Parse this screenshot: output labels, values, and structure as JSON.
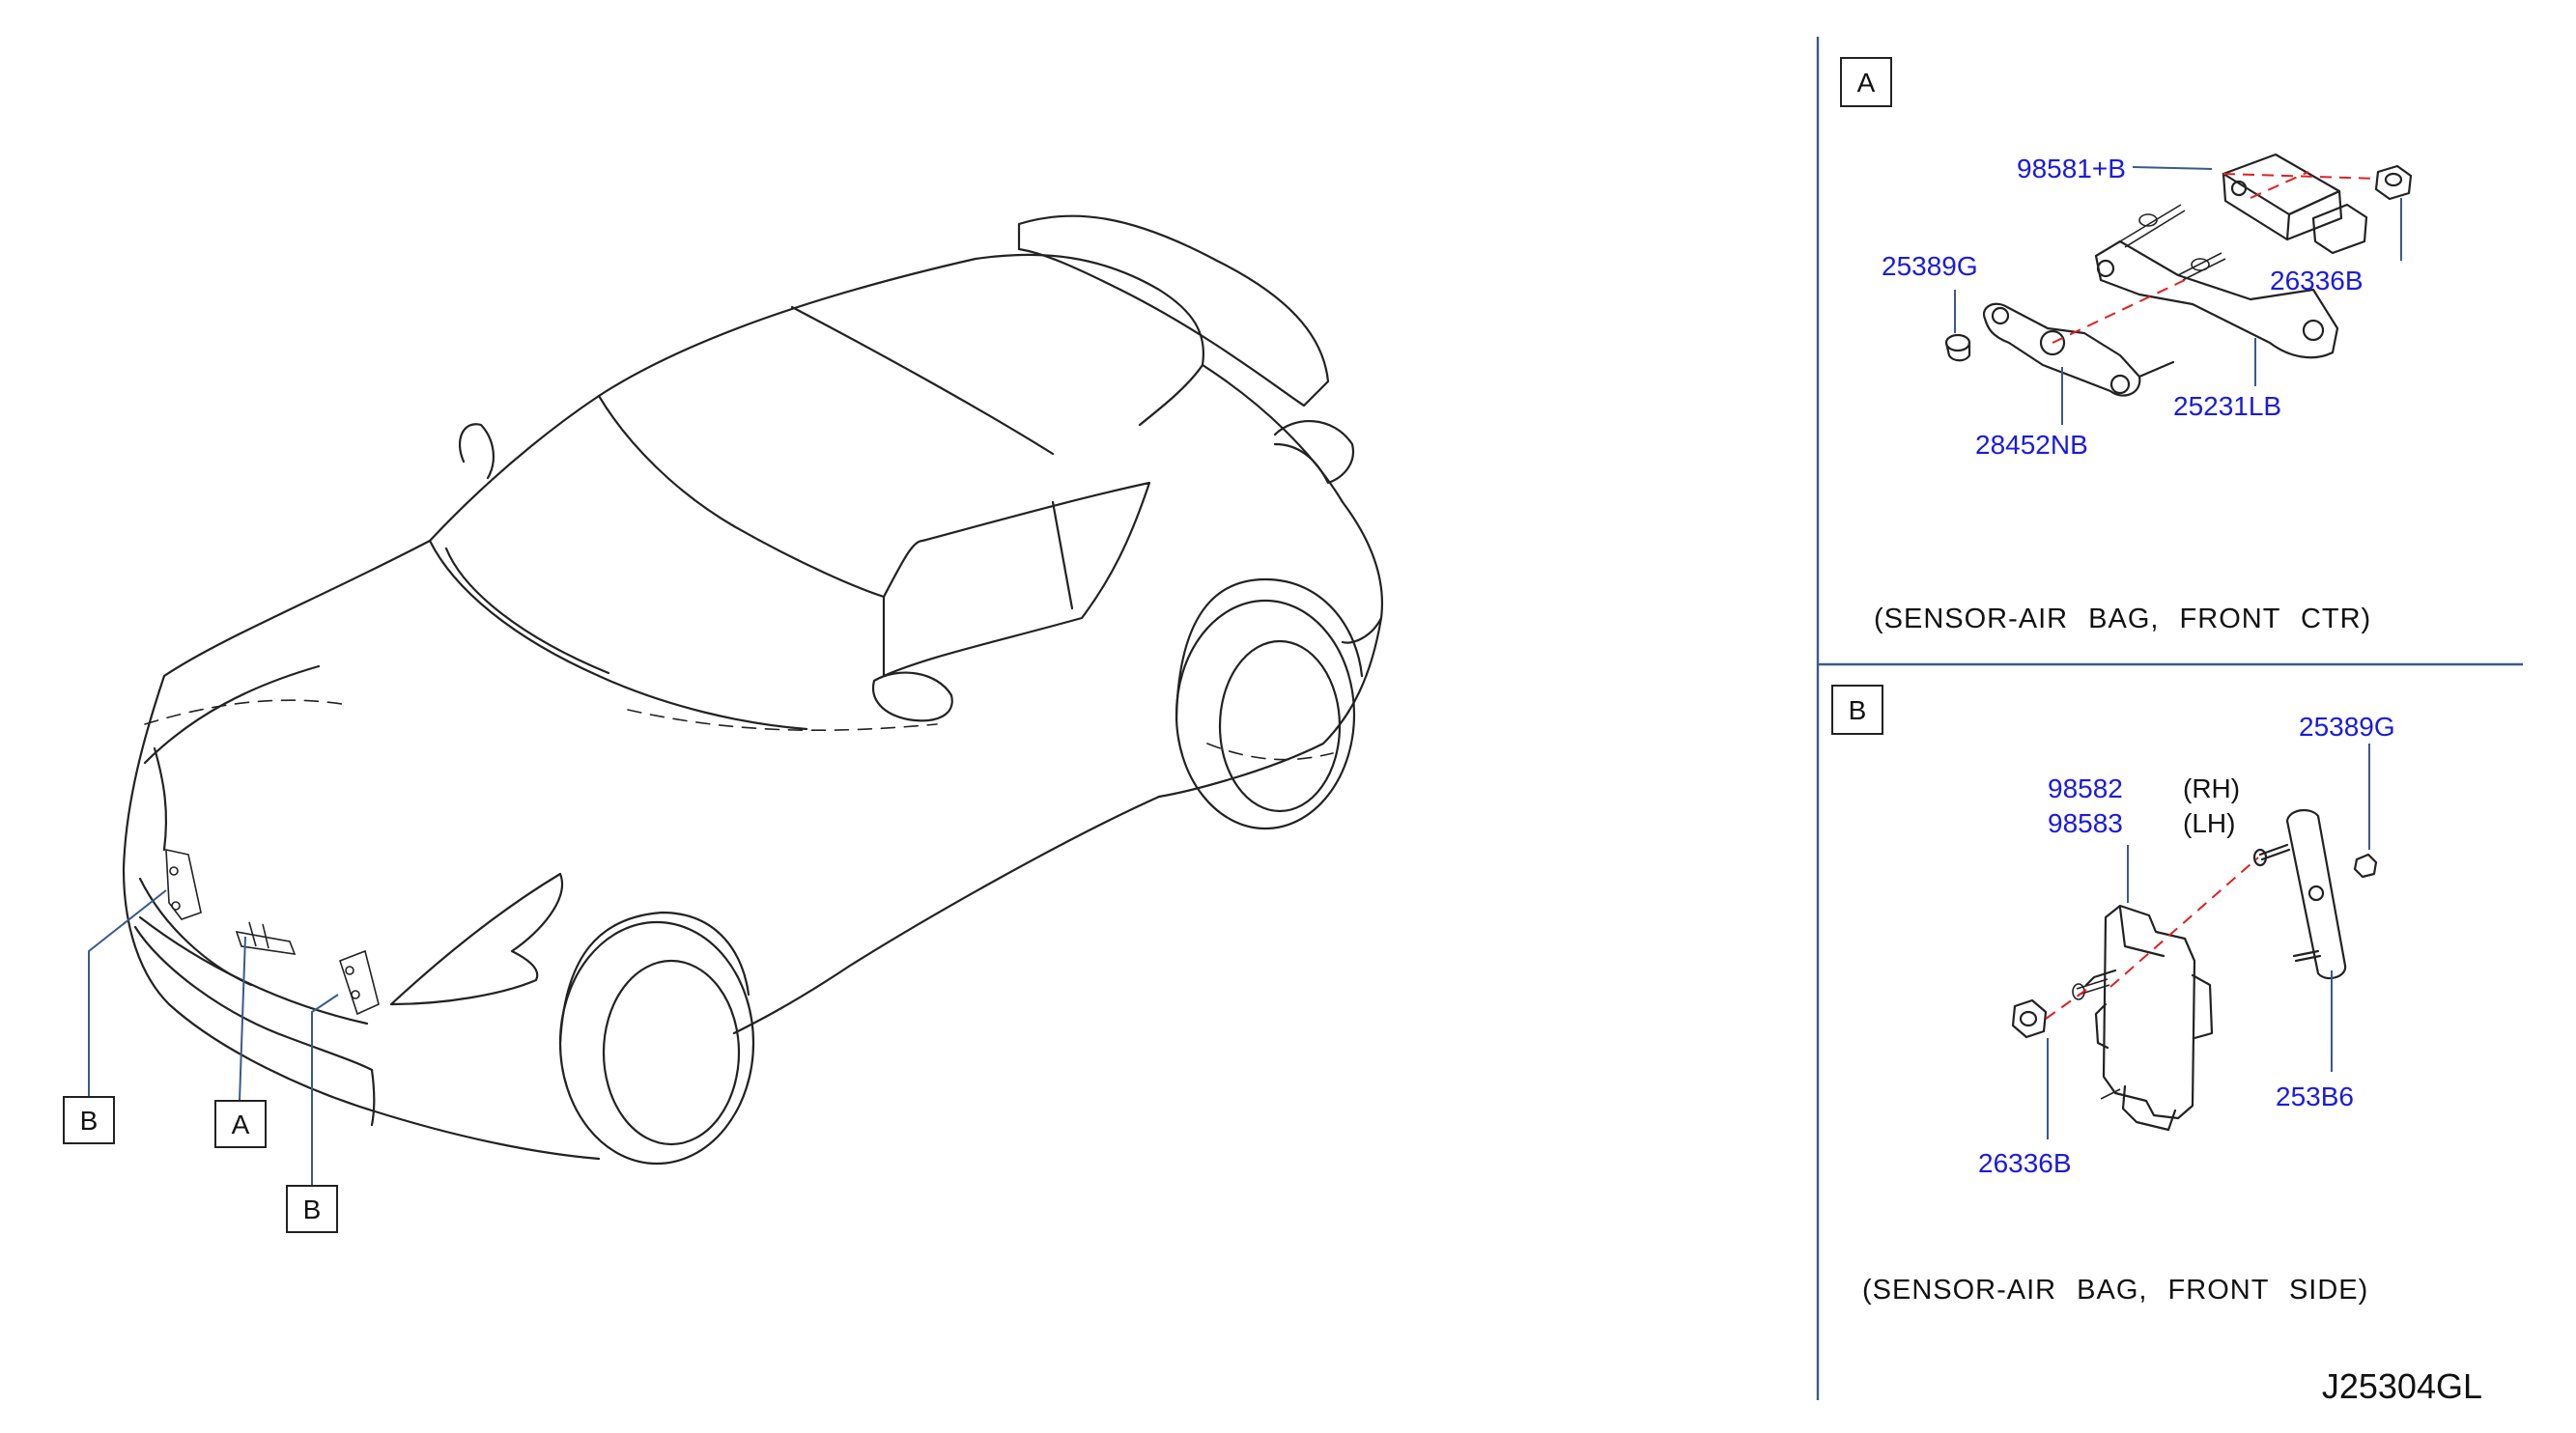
{
  "diagram": {
    "code": "J25304GL",
    "panel_a": {
      "letter": "A",
      "caption": "(SENSOR-AIR  BAG,  FRONT  CTR)",
      "parts": {
        "p98581": "98581+B",
        "p25389g": "25389G",
        "p26336b": "26336B",
        "p25231lb": "25231LB",
        "p28452nb": "28452NB"
      }
    },
    "panel_b": {
      "letter": "B",
      "caption": "(SENSOR-AIR  BAG,  FRONT  SIDE)",
      "parts": {
        "p25389g": "25389G",
        "p98582": "98582",
        "p98582_side": "(RH)",
        "p98583": "98583",
        "p98583_side": "(LH)",
        "p253b6": "253B6",
        "p26336b": "26336B"
      }
    },
    "car_callouts": {
      "left_b": "B",
      "center_a": "A",
      "right_b": "B"
    }
  }
}
